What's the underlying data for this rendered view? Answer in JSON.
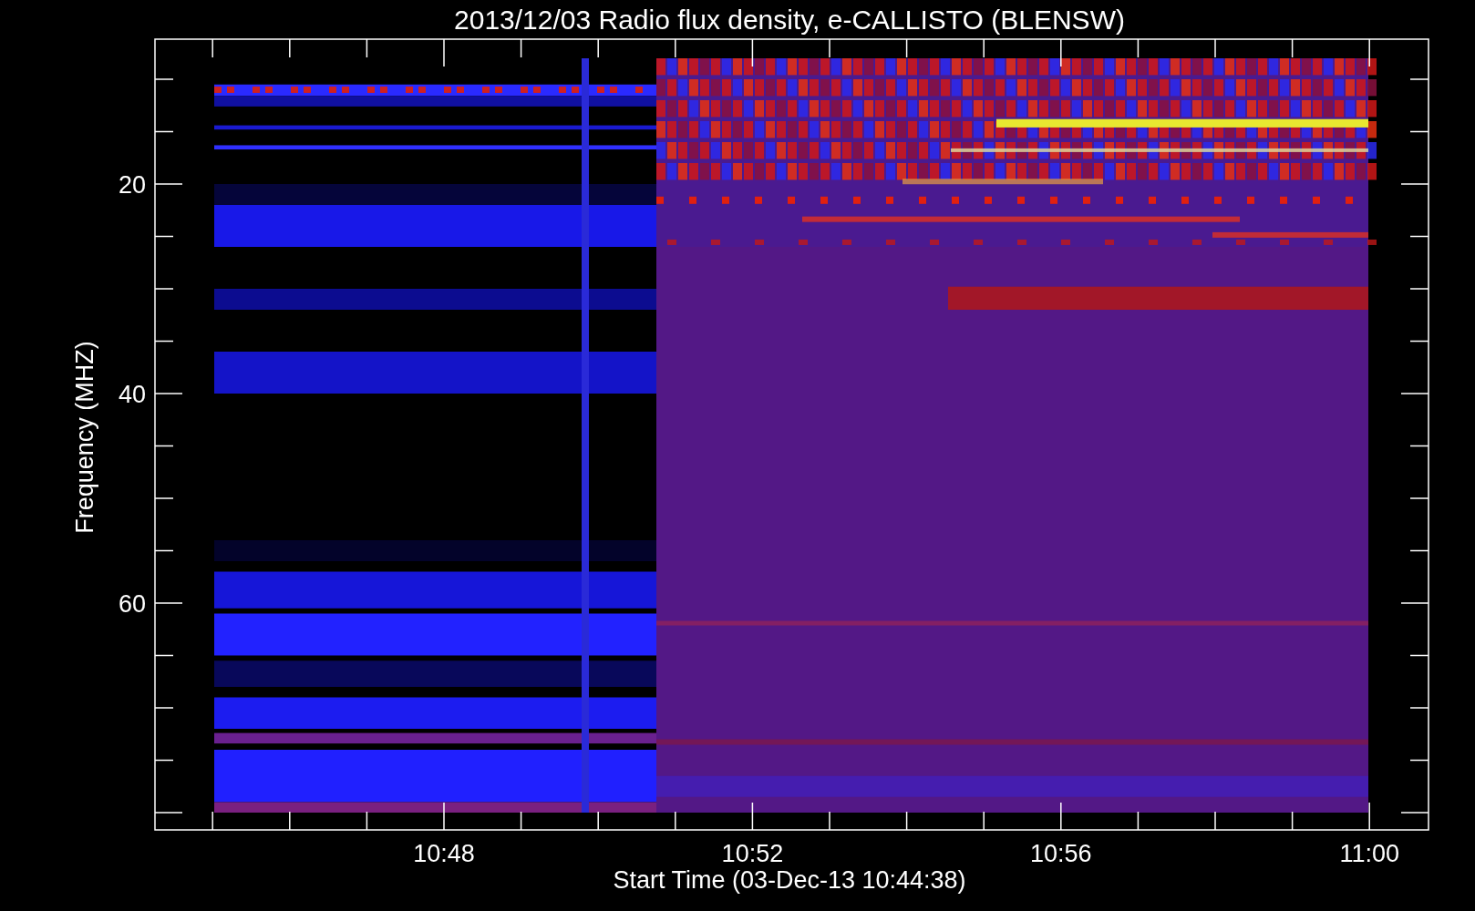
{
  "title": "2013/12/03  Radio flux density, e-CALLISTO (BLENSW)",
  "y_axis": {
    "label": "Frequency (MHZ)",
    "ticks": [
      "20",
      "40",
      "60"
    ]
  },
  "x_axis": {
    "label": "Start Time (03-Dec-13 10:44:38)",
    "ticks": [
      "10:48",
      "10:52",
      "10:56",
      "11:00"
    ]
  }
}
